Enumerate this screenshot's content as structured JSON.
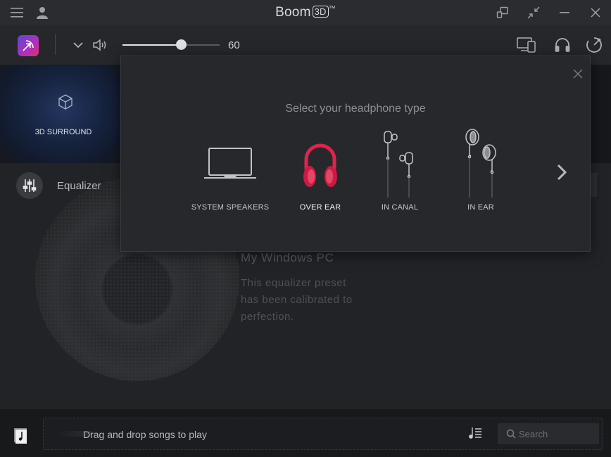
{
  "titlebar": {
    "app_name": "Boom",
    "app_badge": "3D",
    "trademark": "™",
    "icons": [
      "menu-icon",
      "user-icon",
      "remote-icon",
      "minimize-mode-icon",
      "minimize-icon",
      "close-icon"
    ]
  },
  "toolbar": {
    "volume_value": "60",
    "volume_level": 0.6,
    "icons": [
      "boom-logo-icon",
      "chevron-down-icon",
      "speaker-icon",
      "devices-icon",
      "headphones-icon",
      "timer-icon"
    ]
  },
  "effects": {
    "surround_label": "3D SURROUND"
  },
  "equalizer": {
    "label": "Equalizer",
    "preset_name": "My Windows PC",
    "preset_description": "This equalizer preset has been calibrated to perfection."
  },
  "modal": {
    "title": "Select your headphone type",
    "options": [
      {
        "label": "SYSTEM SPEAKERS",
        "selected": false
      },
      {
        "label": "OVER EAR",
        "selected": true
      },
      {
        "label": "IN CANAL",
        "selected": false
      },
      {
        "label": "IN EAR",
        "selected": false
      }
    ],
    "accent_color": "#e0234e"
  },
  "bottombar": {
    "drop_text": "Drag and drop songs to play",
    "search_placeholder": "Search"
  }
}
